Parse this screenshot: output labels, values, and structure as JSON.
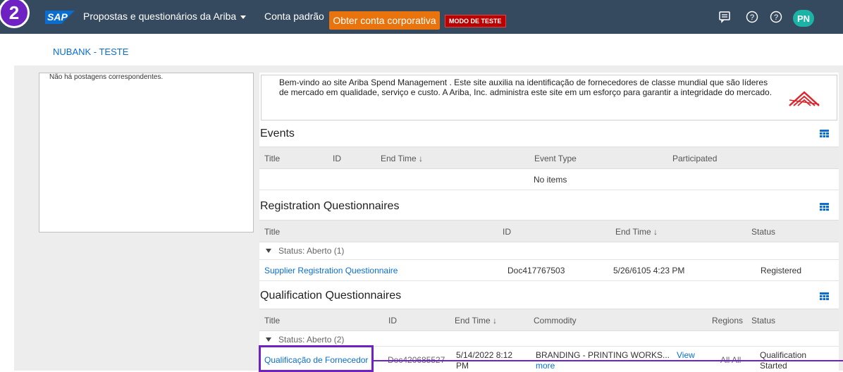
{
  "step_badge": "2",
  "topbar": {
    "logo": "SAP",
    "app_title": "Propostas e questionários da Ariba",
    "account": "Conta padrão",
    "upgrade_button": "Obter conta corporativa",
    "test_mode_badge": "MODO DE TESTE",
    "icons": [
      "notifications-icon",
      "help-icon",
      "help-icon"
    ],
    "avatar": "PN",
    "accent_color": "#e9730c",
    "highlight_color": "#6e22c4"
  },
  "tenant_link": "NUBANK - TESTE",
  "left_panel": {
    "message": "Não há postagens correspondentes."
  },
  "welcome": {
    "text": "Bem-vindo ao site Ariba Spend Management . Este site auxilia na identificação de fornecedores de classe mundial que são líderes de mercado em qualidade, serviço e custo. A Ariba, Inc. administra este site em um esforço para garantir a integridade do mercado."
  },
  "events": {
    "title": "Events",
    "columns": {
      "title": "Title",
      "id": "ID",
      "end_time": "End Time ↓",
      "event_type": "Event Type",
      "participated": "Participated"
    },
    "empty": "No items"
  },
  "registration": {
    "title": "Registration Questionnaires",
    "columns": {
      "title": "Title",
      "id": "ID",
      "end_time": "End Time ↓",
      "status": "Status"
    },
    "group": "Status: Aberto (1)",
    "rows": [
      {
        "title": "Supplier Registration Questionnaire",
        "id": "Doc417767503",
        "end_time": "5/26/6105 4:23 PM",
        "status": "Registered"
      }
    ]
  },
  "qualification": {
    "title": "Qualification Questionnaires",
    "columns": {
      "title": "Title",
      "id": "ID",
      "end_time": "End Time ↓",
      "commodity": "Commodity",
      "regions": "Regions",
      "status": "Status"
    },
    "group": "Status: Aberto (2)",
    "rows": [
      {
        "title": "Qualificação de Fornecedor",
        "id": "Doc420685527",
        "end_time_1": "5/14/2022 8:12",
        "end_time_2": "PM",
        "commodity": "BRANDING - PRINTING WORKS...",
        "view": "View",
        "more": "more",
        "regions": "All All",
        "status_1": "Qualification",
        "status_2": "Started"
      }
    ]
  }
}
